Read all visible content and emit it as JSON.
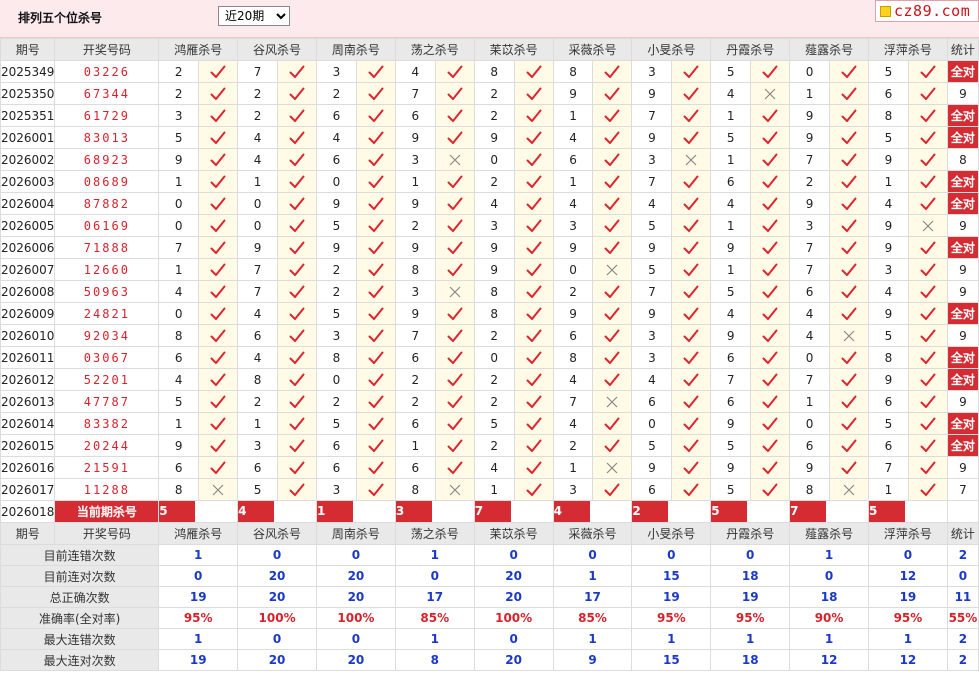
{
  "page": {
    "title": "排列五个位杀号",
    "period_options": [
      "近20期"
    ],
    "period_selected": "近20期",
    "logo": "cz89.com"
  },
  "columns": {
    "issue": "期号",
    "draw": "开奖号码",
    "experts": [
      "鸿雁杀号",
      "谷风杀号",
      "周南杀号",
      "荡之杀号",
      "苿苡杀号",
      "采薇杀号",
      "小旻杀号",
      "丹霞杀号",
      "薤露杀号",
      "浮萍杀号"
    ],
    "total": "统计"
  },
  "rows": [
    {
      "issue": "2025349",
      "draw": "03226",
      "kills": [
        2,
        7,
        3,
        4,
        8,
        8,
        3,
        5,
        0,
        5
      ],
      "ok": [
        1,
        1,
        1,
        1,
        1,
        1,
        1,
        1,
        1,
        1
      ],
      "stat": "全对"
    },
    {
      "issue": "2025350",
      "draw": "67344",
      "kills": [
        2,
        2,
        2,
        7,
        2,
        9,
        9,
        4,
        1,
        6
      ],
      "ok": [
        1,
        1,
        1,
        1,
        1,
        1,
        1,
        0,
        1,
        1
      ],
      "stat": "9"
    },
    {
      "issue": "2025351",
      "draw": "61729",
      "kills": [
        3,
        2,
        6,
        6,
        2,
        1,
        7,
        1,
        9,
        8
      ],
      "ok": [
        1,
        1,
        1,
        1,
        1,
        1,
        1,
        1,
        1,
        1
      ],
      "stat": "全对"
    },
    {
      "issue": "2026001",
      "draw": "83013",
      "kills": [
        5,
        4,
        4,
        9,
        9,
        4,
        9,
        5,
        9,
        5
      ],
      "ok": [
        1,
        1,
        1,
        1,
        1,
        1,
        1,
        1,
        1,
        1
      ],
      "stat": "全对"
    },
    {
      "issue": "2026002",
      "draw": "68923",
      "kills": [
        9,
        4,
        6,
        3,
        0,
        6,
        3,
        1,
        7,
        9
      ],
      "ok": [
        1,
        1,
        1,
        0,
        1,
        1,
        0,
        1,
        1,
        1
      ],
      "stat": "8"
    },
    {
      "issue": "2026003",
      "draw": "08689",
      "kills": [
        1,
        1,
        0,
        1,
        2,
        1,
        7,
        6,
        2,
        1
      ],
      "ok": [
        1,
        1,
        1,
        1,
        1,
        1,
        1,
        1,
        1,
        1
      ],
      "stat": "全对"
    },
    {
      "issue": "2026004",
      "draw": "87882",
      "kills": [
        0,
        0,
        9,
        9,
        4,
        4,
        4,
        4,
        9,
        4
      ],
      "ok": [
        1,
        1,
        1,
        1,
        1,
        1,
        1,
        1,
        1,
        1
      ],
      "stat": "全对"
    },
    {
      "issue": "2026005",
      "draw": "06169",
      "kills": [
        0,
        0,
        5,
        2,
        3,
        3,
        5,
        1,
        3,
        9
      ],
      "ok": [
        1,
        1,
        1,
        1,
        1,
        1,
        1,
        1,
        1,
        0
      ],
      "stat": "9"
    },
    {
      "issue": "2026006",
      "draw": "71888",
      "kills": [
        7,
        9,
        9,
        9,
        9,
        9,
        9,
        9,
        7,
        9
      ],
      "ok": [
        1,
        1,
        1,
        1,
        1,
        1,
        1,
        1,
        1,
        1
      ],
      "stat": "全对"
    },
    {
      "issue": "2026007",
      "draw": "12660",
      "kills": [
        1,
        7,
        2,
        8,
        9,
        0,
        5,
        1,
        7,
        3
      ],
      "ok": [
        1,
        1,
        1,
        1,
        1,
        0,
        1,
        1,
        1,
        1
      ],
      "stat": "9"
    },
    {
      "issue": "2026008",
      "draw": "50963",
      "kills": [
        4,
        7,
        2,
        3,
        8,
        2,
        7,
        5,
        6,
        4
      ],
      "ok": [
        1,
        1,
        1,
        0,
        1,
        1,
        1,
        1,
        1,
        1
      ],
      "stat": "9"
    },
    {
      "issue": "2026009",
      "draw": "24821",
      "kills": [
        0,
        4,
        5,
        9,
        8,
        9,
        9,
        4,
        4,
        9
      ],
      "ok": [
        1,
        1,
        1,
        1,
        1,
        1,
        1,
        1,
        1,
        1
      ],
      "stat": "全对"
    },
    {
      "issue": "2026010",
      "draw": "92034",
      "kills": [
        8,
        6,
        3,
        7,
        2,
        6,
        3,
        9,
        4,
        5
      ],
      "ok": [
        1,
        1,
        1,
        1,
        1,
        1,
        1,
        1,
        0,
        1
      ],
      "stat": "9"
    },
    {
      "issue": "2026011",
      "draw": "03067",
      "kills": [
        6,
        4,
        8,
        6,
        0,
        8,
        3,
        6,
        0,
        8
      ],
      "ok": [
        1,
        1,
        1,
        1,
        1,
        1,
        1,
        1,
        1,
        1
      ],
      "stat": "全对"
    },
    {
      "issue": "2026012",
      "draw": "52201",
      "kills": [
        4,
        8,
        0,
        2,
        2,
        4,
        4,
        7,
        7,
        9
      ],
      "ok": [
        1,
        1,
        1,
        1,
        1,
        1,
        1,
        1,
        1,
        1
      ],
      "stat": "全对"
    },
    {
      "issue": "2026013",
      "draw": "47787",
      "kills": [
        5,
        2,
        2,
        2,
        2,
        7,
        6,
        6,
        1,
        6
      ],
      "ok": [
        1,
        1,
        1,
        1,
        1,
        0,
        1,
        1,
        1,
        1
      ],
      "stat": "9"
    },
    {
      "issue": "2026014",
      "draw": "83382",
      "kills": [
        1,
        1,
        5,
        6,
        5,
        4,
        0,
        9,
        0,
        5
      ],
      "ok": [
        1,
        1,
        1,
        1,
        1,
        1,
        1,
        1,
        1,
        1
      ],
      "stat": "全对"
    },
    {
      "issue": "2026015",
      "draw": "20244",
      "kills": [
        9,
        3,
        6,
        1,
        2,
        2,
        5,
        5,
        6,
        6
      ],
      "ok": [
        1,
        1,
        1,
        1,
        1,
        1,
        1,
        1,
        1,
        1
      ],
      "stat": "全对"
    },
    {
      "issue": "2026016",
      "draw": "21591",
      "kills": [
        6,
        6,
        6,
        6,
        4,
        1,
        9,
        9,
        9,
        7
      ],
      "ok": [
        1,
        1,
        1,
        1,
        1,
        0,
        1,
        1,
        1,
        1
      ],
      "stat": "9"
    },
    {
      "issue": "2026017",
      "draw": "11288",
      "kills": [
        8,
        5,
        3,
        8,
        1,
        3,
        6,
        5,
        8,
        1
      ],
      "ok": [
        0,
        1,
        1,
        0,
        1,
        1,
        1,
        1,
        0,
        1
      ],
      "stat": "7"
    }
  ],
  "current": {
    "issue": "2026018",
    "label": "当前期杀号",
    "kills": [
      5,
      4,
      1,
      3,
      7,
      4,
      2,
      5,
      7,
      5
    ]
  },
  "stats": [
    {
      "label": "目前连错次数",
      "values": [
        "1",
        "0",
        "0",
        "1",
        "0",
        "0",
        "0",
        "0",
        "1",
        "0"
      ],
      "total": "2",
      "color": "blue"
    },
    {
      "label": "目前连对次数",
      "values": [
        "0",
        "20",
        "20",
        "0",
        "20",
        "1",
        "15",
        "18",
        "0",
        "12"
      ],
      "total": "0",
      "color": "blue"
    },
    {
      "label": "总正确次数",
      "values": [
        "19",
        "20",
        "20",
        "17",
        "20",
        "17",
        "19",
        "19",
        "18",
        "19"
      ],
      "total": "11",
      "color": "blue"
    },
    {
      "label": "准确率(全对率)",
      "values": [
        "95%",
        "100%",
        "100%",
        "85%",
        "100%",
        "85%",
        "95%",
        "95%",
        "90%",
        "95%"
      ],
      "total": "55%",
      "color": "red"
    },
    {
      "label": "最大连错次数",
      "values": [
        "1",
        "0",
        "0",
        "1",
        "0",
        "1",
        "1",
        "1",
        "1",
        "1"
      ],
      "total": "2",
      "color": "blue"
    },
    {
      "label": "最大连对次数",
      "values": [
        "19",
        "20",
        "20",
        "8",
        "20",
        "9",
        "15",
        "18",
        "12",
        "12"
      ],
      "total": "2",
      "color": "blue"
    }
  ],
  "colors": {
    "accent": "#d52c33",
    "mark_bg": "#fffbe6",
    "header_bg": "#e9e9e9",
    "stat_blue": "#1a39c8"
  }
}
